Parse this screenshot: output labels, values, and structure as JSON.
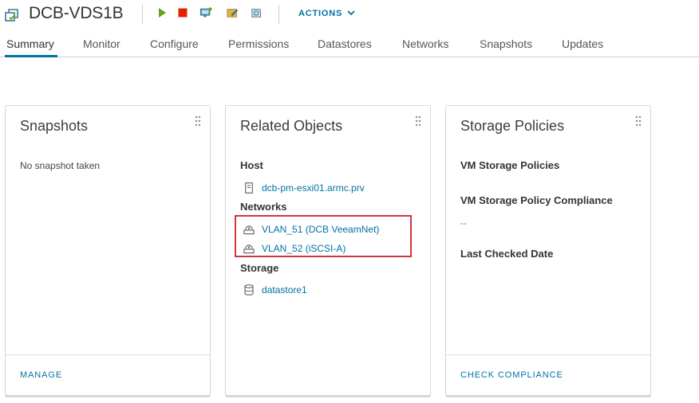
{
  "header": {
    "title": "DCB-VDS1B",
    "actions_label": "ACTIONS",
    "toolbar_icons": [
      "vm-icon",
      "power-on-icon",
      "power-off-icon",
      "console-icon",
      "edit-icon",
      "snapshot-icon"
    ]
  },
  "tabs": [
    {
      "label": "Summary",
      "active": true
    },
    {
      "label": "Monitor"
    },
    {
      "label": "Configure"
    },
    {
      "label": "Permissions"
    },
    {
      "label": "Datastores"
    },
    {
      "label": "Networks"
    },
    {
      "label": "Snapshots"
    },
    {
      "label": "Updates"
    }
  ],
  "snapshots_card": {
    "title": "Snapshots",
    "empty_text": "No snapshot taken",
    "footer_link": "MANAGE"
  },
  "related_card": {
    "title": "Related Objects",
    "host_label": "Host",
    "host_link": "dcb-pm-esxi01.armc.prv",
    "networks_label": "Networks",
    "networks": [
      "VLAN_51 (DCB VeeamNet)",
      "VLAN_52 (iSCSI-A)"
    ],
    "storage_label": "Storage",
    "storage_link": "datastore1"
  },
  "storage_card": {
    "title": "Storage Policies",
    "policies_label": "VM Storage Policies",
    "compliance_label": "VM Storage Policy Compliance",
    "compliance_value": "--",
    "last_checked_label": "Last Checked Date",
    "footer_link": "CHECK COMPLIANCE"
  },
  "colors": {
    "link": "#0072a3",
    "highlight": "#d0363a",
    "power_on": "#62a420",
    "power_off": "#e12200"
  }
}
